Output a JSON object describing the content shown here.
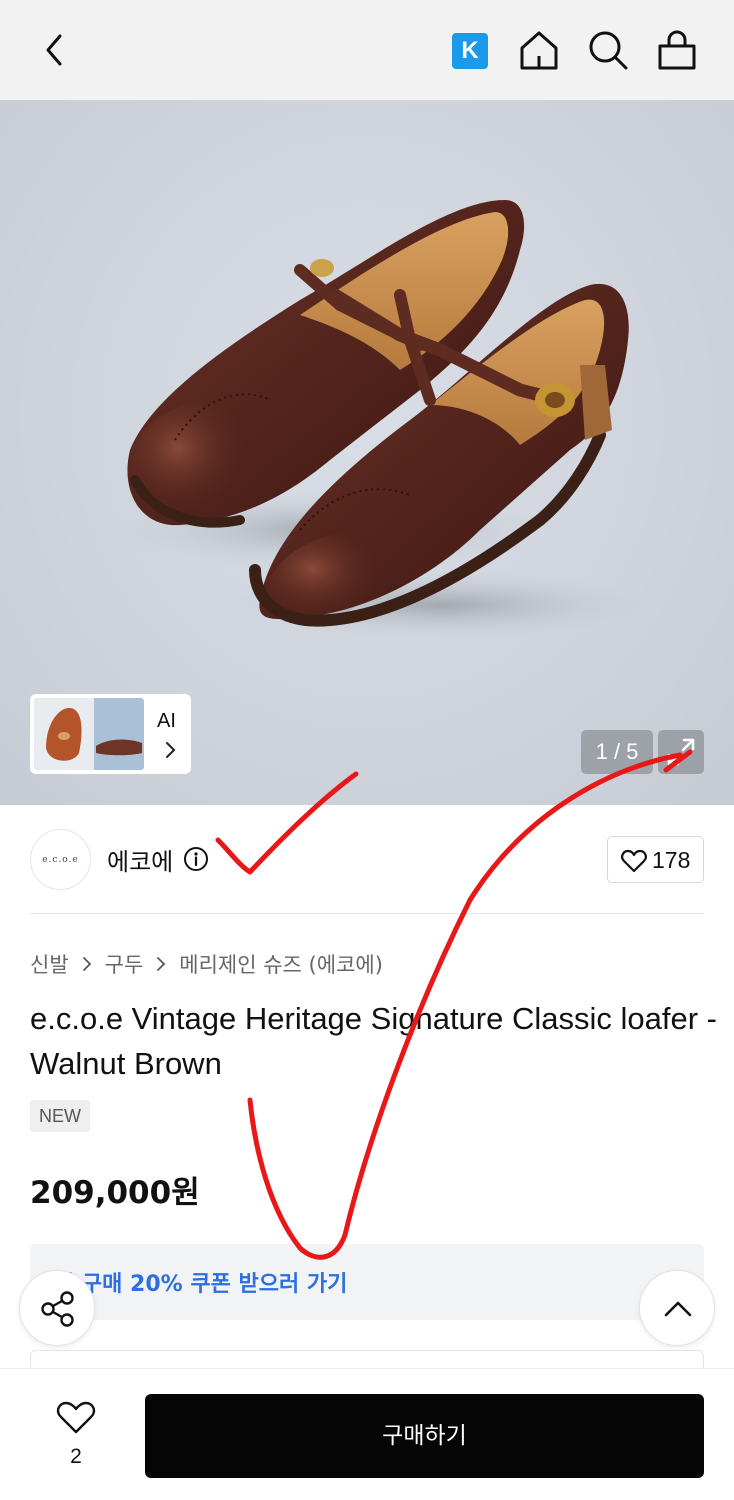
{
  "header": {
    "back_icon": "chevron-left-icon",
    "kakao_badge": "K",
    "icons": [
      "home-icon",
      "search-icon",
      "shopping-bag-icon"
    ]
  },
  "gallery": {
    "ai_label": "AI",
    "counter": "1 / 5",
    "expand_icon": "expand-icon"
  },
  "brand": {
    "logo_text": "e.c.o.e",
    "name": "에코에",
    "like_count": "178"
  },
  "breadcrumb": [
    "신발",
    "구두",
    "메리제인 슈즈 (에코에)"
  ],
  "product": {
    "title": "e.c.o.e Vintage Heritage Signature Classic loafer - Walnut Brown",
    "badge": "NEW",
    "price": "209,000원"
  },
  "coupon": {
    "text": "첫 구매 20% 쿠폰 받으러 가기"
  },
  "bottom": {
    "wish_count": "2",
    "buy_label": "구매하기"
  },
  "colors": {
    "accent_blue": "#2b6fe0",
    "buy_button": "#050505",
    "kakao_badge": "#1a9ae8",
    "annotation_red": "#e81818"
  }
}
